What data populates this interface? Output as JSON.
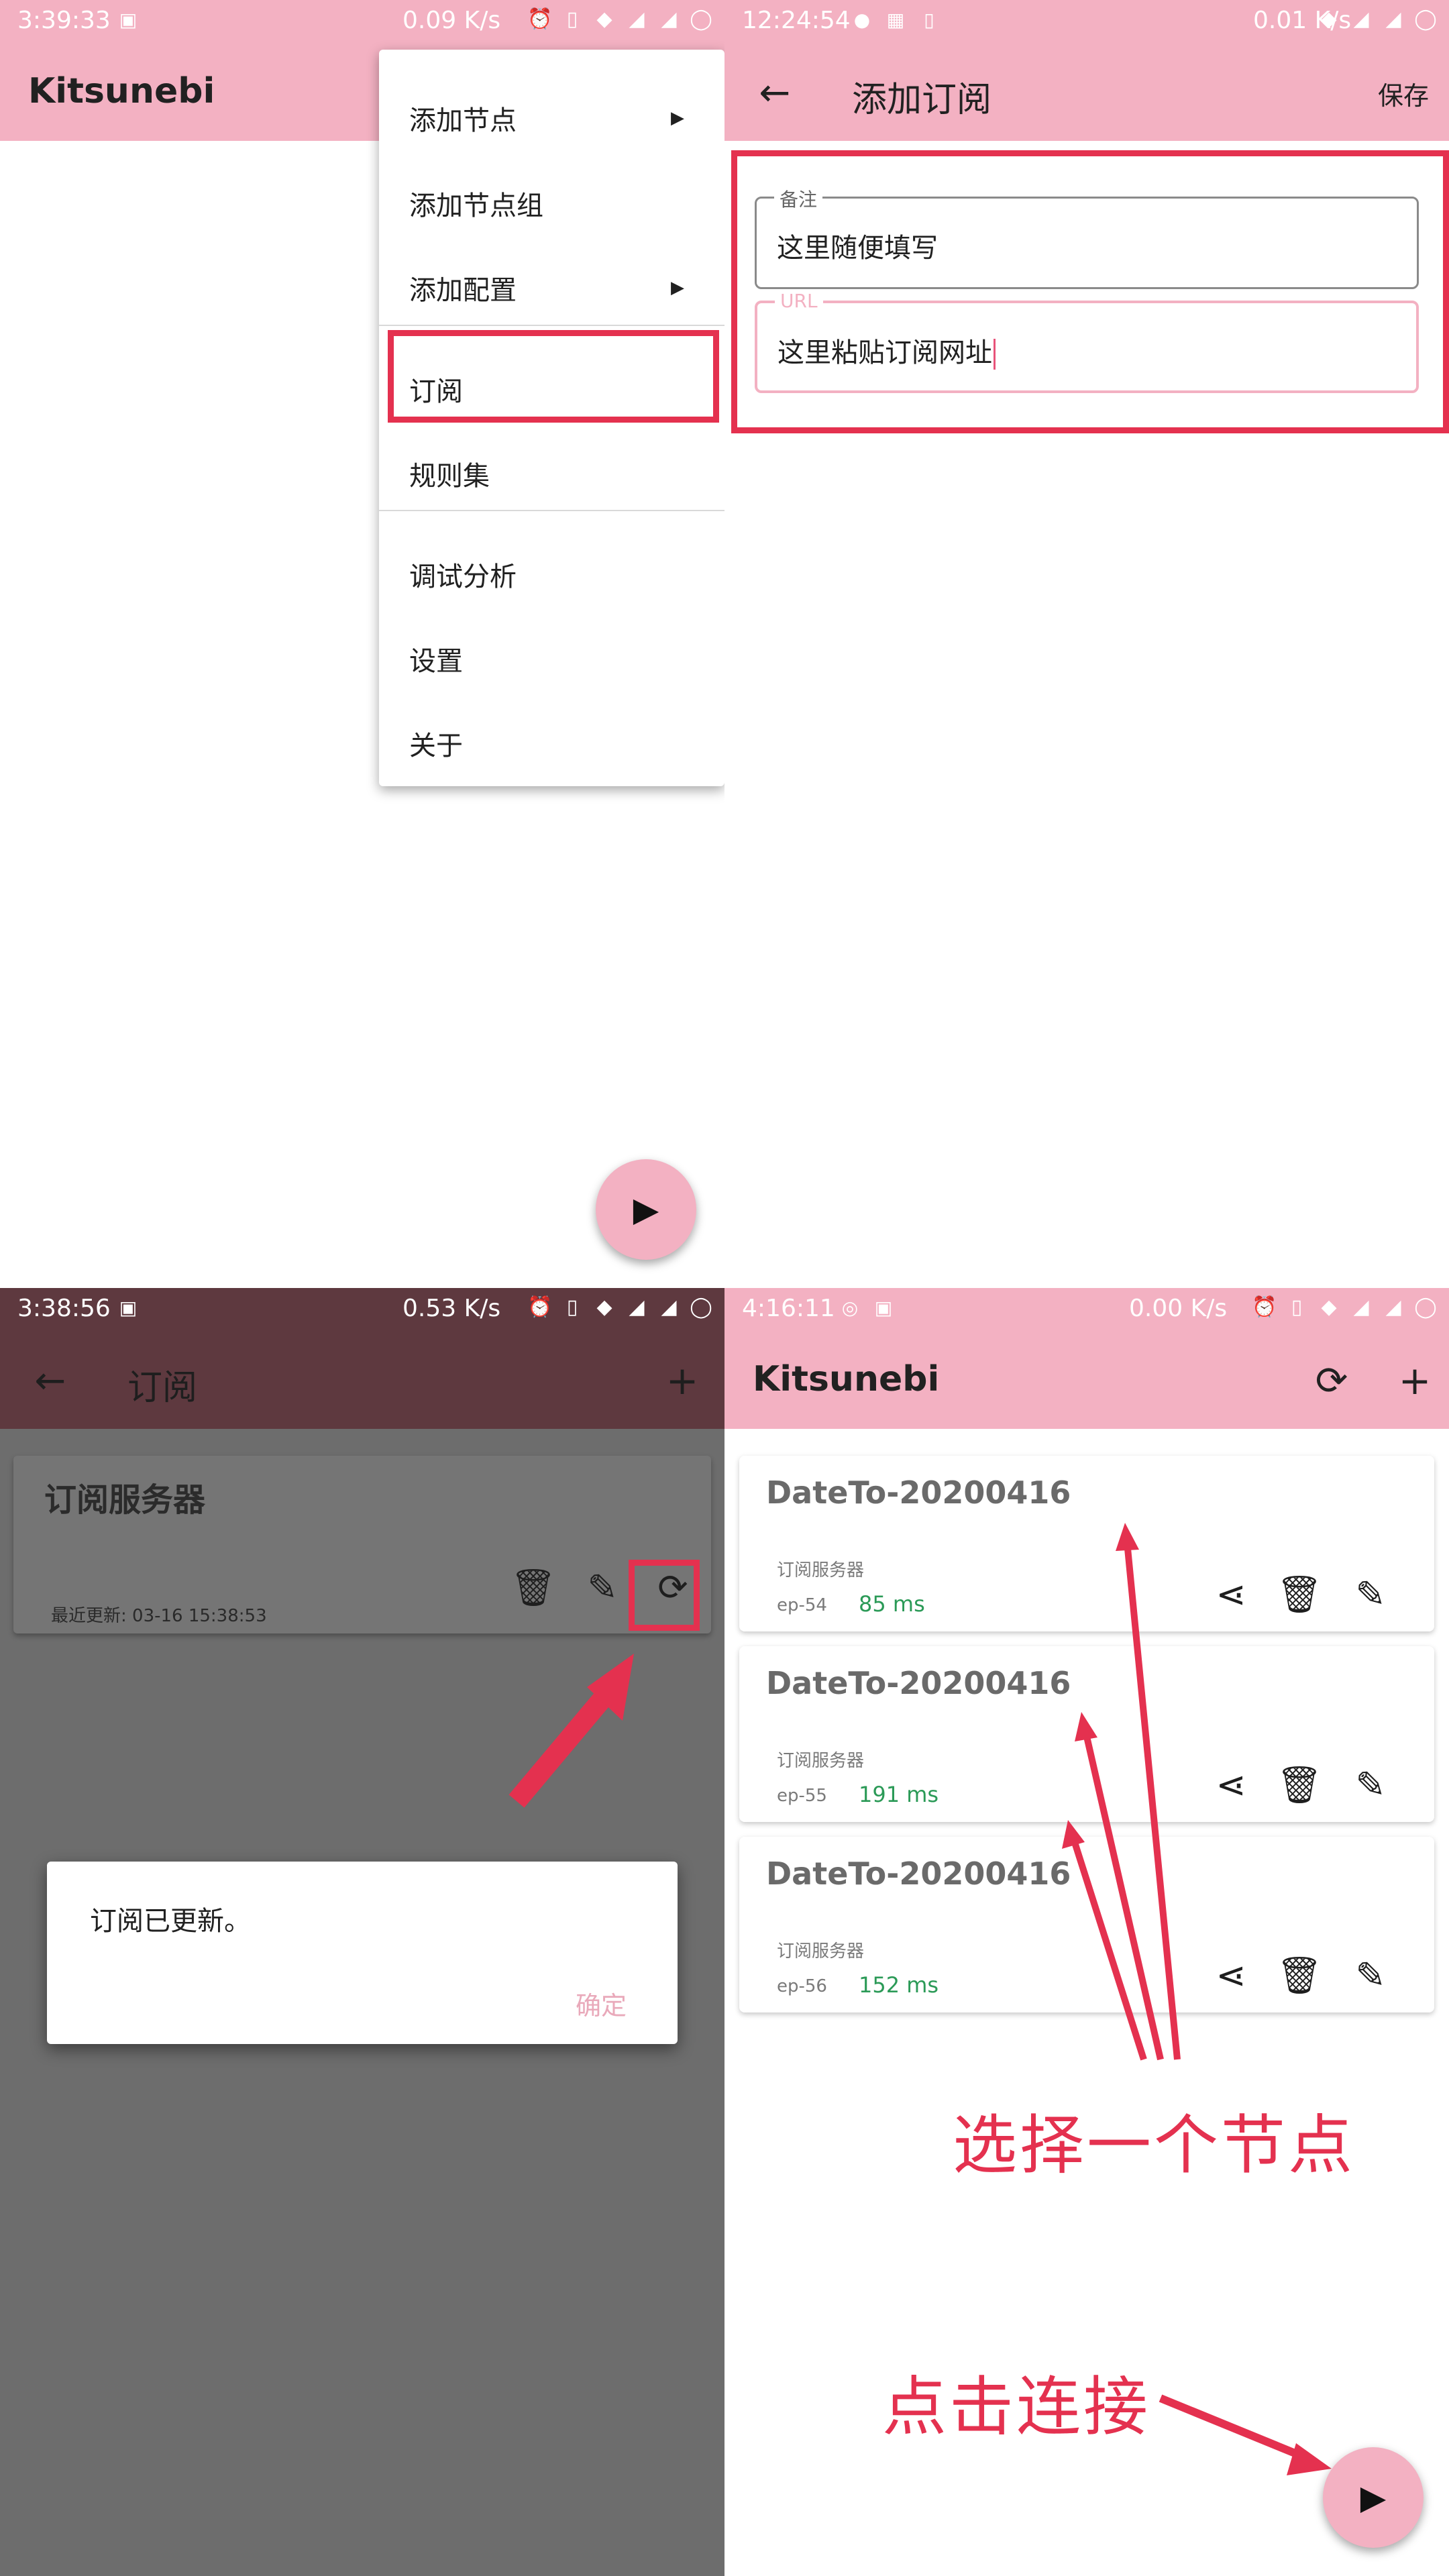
{
  "q1": {
    "status": {
      "time": "3:39:33",
      "speed": "0.09 K/s"
    },
    "title": "Kitsunebi",
    "menu": [
      {
        "label": "添加节点",
        "arrow": true
      },
      {
        "label": "添加节点组",
        "arrow": false
      },
      {
        "label": "添加配置",
        "arrow": true
      },
      {
        "label": "订阅",
        "arrow": false
      },
      {
        "label": "规则集",
        "arrow": false
      },
      {
        "label": "调试分析",
        "arrow": false
      },
      {
        "label": "设置",
        "arrow": false
      },
      {
        "label": "关于",
        "arrow": false
      }
    ]
  },
  "q2": {
    "status": {
      "time": "12:24:54",
      "speed": "0.01 K/s"
    },
    "title": "添加订阅",
    "save_label": "保存",
    "remark": {
      "label": "备注",
      "value": "这里随便填写"
    },
    "url": {
      "label": "URL",
      "value": "这里粘贴订阅网址"
    }
  },
  "q3": {
    "status": {
      "time": "3:38:56",
      "speed": "0.53 K/s"
    },
    "title": "订阅",
    "card": {
      "title": "订阅服务器",
      "updated": "最近更新: 03-16 15:38:53"
    },
    "dialog": {
      "message": "订阅已更新。",
      "ok": "确定"
    }
  },
  "q4": {
    "status": {
      "time": "4:16:11",
      "speed": "0.00 K/s"
    },
    "title": "Kitsunebi",
    "nodes": [
      {
        "name": "DateTo-20200416",
        "group": "订阅服务器",
        "ep": "ep-54",
        "latency": "85 ms"
      },
      {
        "name": "DateTo-20200416",
        "group": "订阅服务器",
        "ep": "ep-55",
        "latency": "191 ms"
      },
      {
        "name": "DateTo-20200416",
        "group": "订阅服务器",
        "ep": "ep-56",
        "latency": "152 ms"
      }
    ],
    "annotation_select": "选择一个节点",
    "annotation_connect": "点击连接"
  },
  "colors": {
    "appbar": "#f3b1c2",
    "highlight": "#e4314f",
    "latency": "#2b9a57"
  }
}
